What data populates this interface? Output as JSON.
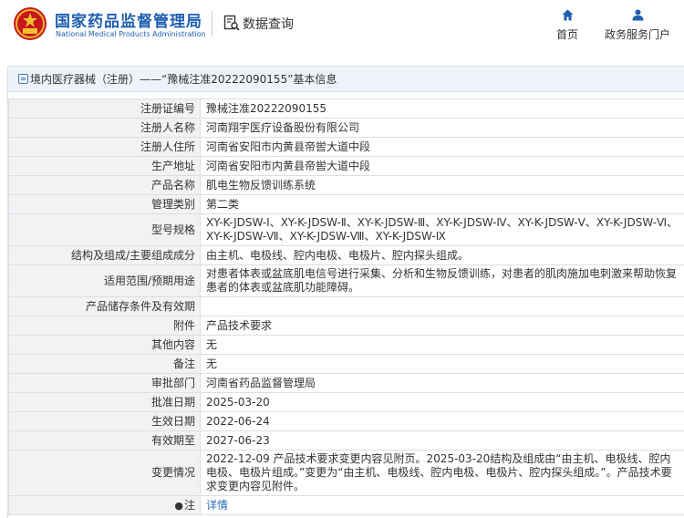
{
  "header": {
    "brand_cn": "国家药品监督管理局",
    "brand_en": "National Medical Products Administration",
    "query_label": "数据查询",
    "nav": [
      {
        "label": "首页",
        "icon": "home-icon"
      },
      {
        "label": "政务服务门户",
        "icon": "user-icon"
      }
    ]
  },
  "colors": {
    "brand": "#1f5fb0",
    "link": "#2a6ebb",
    "label_bg": "#f2f2f2",
    "title_bg": "#eef3f9"
  },
  "panel": {
    "title": "境内医疗器械（注册）——“豫械注准20222090155”基本信息"
  },
  "rows": [
    {
      "label": "注册证编号",
      "value": "豫械注准20222090155"
    },
    {
      "label": "注册人名称",
      "value": "河南翔宇医疗设备股份有限公司"
    },
    {
      "label": "注册人住所",
      "value": "河南省安阳市内黄县帝喾大道中段"
    },
    {
      "label": "生产地址",
      "value": "河南省安阳市内黄县帝喾大道中段"
    },
    {
      "label": "产品名称",
      "value": "肌电生物反馈训练系统"
    },
    {
      "label": "管理类别",
      "value": "第二类"
    },
    {
      "label": "型号规格",
      "value": "XY-K-JDSW-Ⅰ、XY-K-JDSW-Ⅱ、XY-K-JDSW-Ⅲ、XY-K-JDSW-Ⅳ、XY-K-JDSW-Ⅴ、XY-K-JDSW-Ⅵ、XY-K-JDSW-Ⅶ、XY-K-JDSW-Ⅷ、XY-K-JDSW-Ⅸ"
    },
    {
      "label": "结构及组成/主要组成成分",
      "value": "由主机、电极线、腔内电极、电极片、腔内探头组成。"
    },
    {
      "label": "适用范围/预期用途",
      "value": "对患者体表或盆底肌电信号进行采集、分析和生物反馈训练，对患者的肌肉施加电刺激来帮助恢复患者的体表或盆底肌功能障碍。"
    },
    {
      "label": "产品储存条件及有效期",
      "value": ""
    },
    {
      "label": "附件",
      "value": "产品技术要求"
    },
    {
      "label": "其他内容",
      "value": "无"
    },
    {
      "label": "备注",
      "value": "无"
    },
    {
      "label": "审批部门",
      "value": "河南省药品监督管理局"
    },
    {
      "label": "批准日期",
      "value": "2025-03-20"
    },
    {
      "label": "生效日期",
      "value": "2022-06-24"
    },
    {
      "label": "有效期至",
      "value": "2027-06-23"
    },
    {
      "label": "变更情况",
      "value": "2022-12-09 产品技术要求变更内容见附页。2025-03-20结构及组成由“由主机、电极线、腔内电极、电极片组成。”变更为“由主机、电极线、腔内电极、电极片、腔内探头组成。”。产品技术要求变更内容见附件。"
    }
  ],
  "note": {
    "label": "注",
    "link": "详情"
  }
}
